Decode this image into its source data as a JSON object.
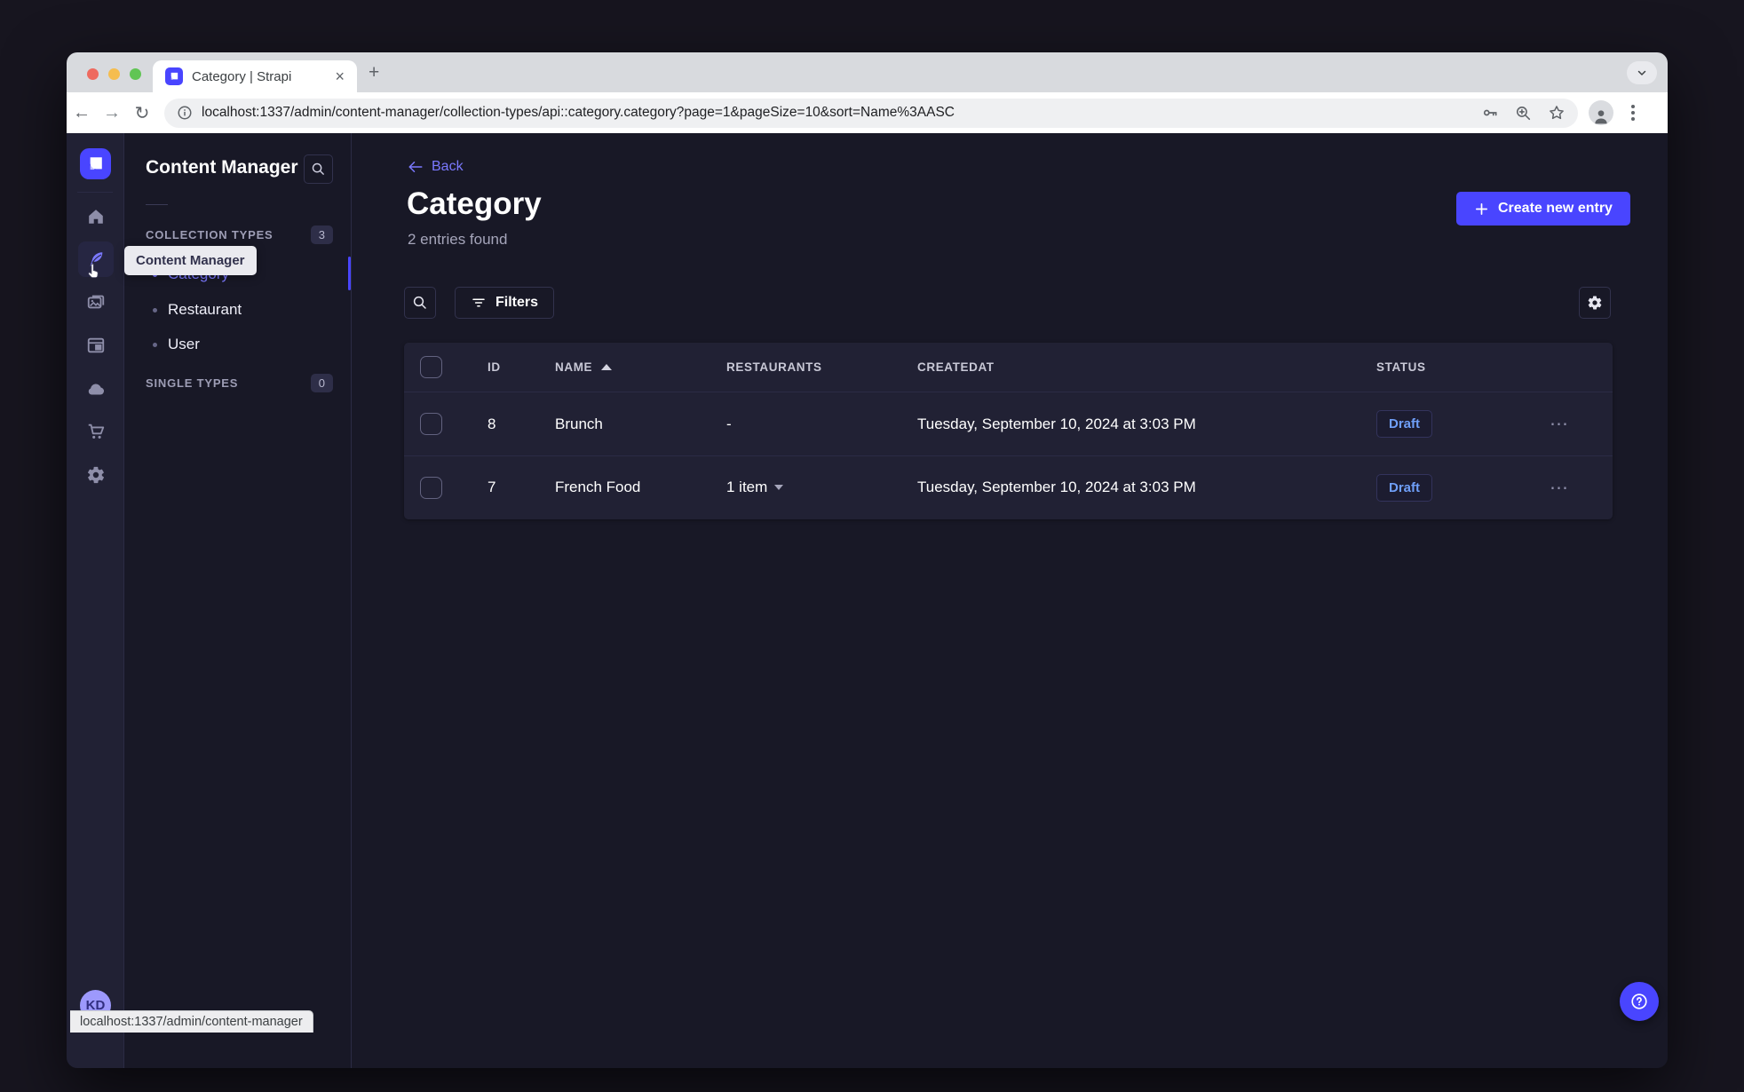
{
  "browser": {
    "tab_title": "Category | Strapi",
    "url": "localhost:1337/admin/content-manager/collection-types/api::category.category?page=1&pageSize=10&sort=Name%3AASC",
    "status_bar_url": "localhost:1337/admin/content-manager",
    "close_glyph": "×",
    "new_tab_glyph": "+",
    "back_glyph": "←",
    "forward_glyph": "→",
    "reload_glyph": "↻"
  },
  "nav": {
    "tooltip": "Content Manager",
    "avatar_initials": "KD",
    "icons": [
      "strapi-logo",
      "home",
      "content-manager",
      "media-library",
      "content-type-builder",
      "cloud",
      "marketplace",
      "settings"
    ]
  },
  "subnav": {
    "title": "Content Manager",
    "sections": [
      {
        "label": "COLLECTION TYPES",
        "count": "3",
        "items": [
          "Category",
          "Restaurant",
          "User"
        ]
      },
      {
        "label": "SINGLE TYPES",
        "count": "0",
        "items": []
      }
    ]
  },
  "main": {
    "back_label": "Back",
    "title": "Category",
    "subtitle": "2 entries found",
    "create_button": "Create new entry",
    "filters_button": "Filters",
    "table": {
      "columns": [
        "ID",
        "NAME",
        "RESTAURANTS",
        "CREATEDAT",
        "STATUS"
      ],
      "sort_column": "NAME",
      "sort_direction": "ASC",
      "rows": [
        {
          "id": "8",
          "name": "Brunch",
          "restaurants": "-",
          "restaurants_expandable": false,
          "created_at": "Tuesday, September 10, 2024 at 3:03 PM",
          "status": "Draft"
        },
        {
          "id": "7",
          "name": "French Food",
          "restaurants": "1 item",
          "restaurants_expandable": true,
          "created_at": "Tuesday, September 10, 2024 at 3:03 PM",
          "status": "Draft"
        }
      ],
      "row_actions_glyph": "⋯"
    }
  },
  "colors": {
    "accent": "#4945ff",
    "link": "#7b79ff",
    "app_background": "#181826",
    "panel_background": "#212134",
    "border": "#32324d",
    "draft_text": "#6f9ff8",
    "text_muted": "#a5a5ba"
  }
}
